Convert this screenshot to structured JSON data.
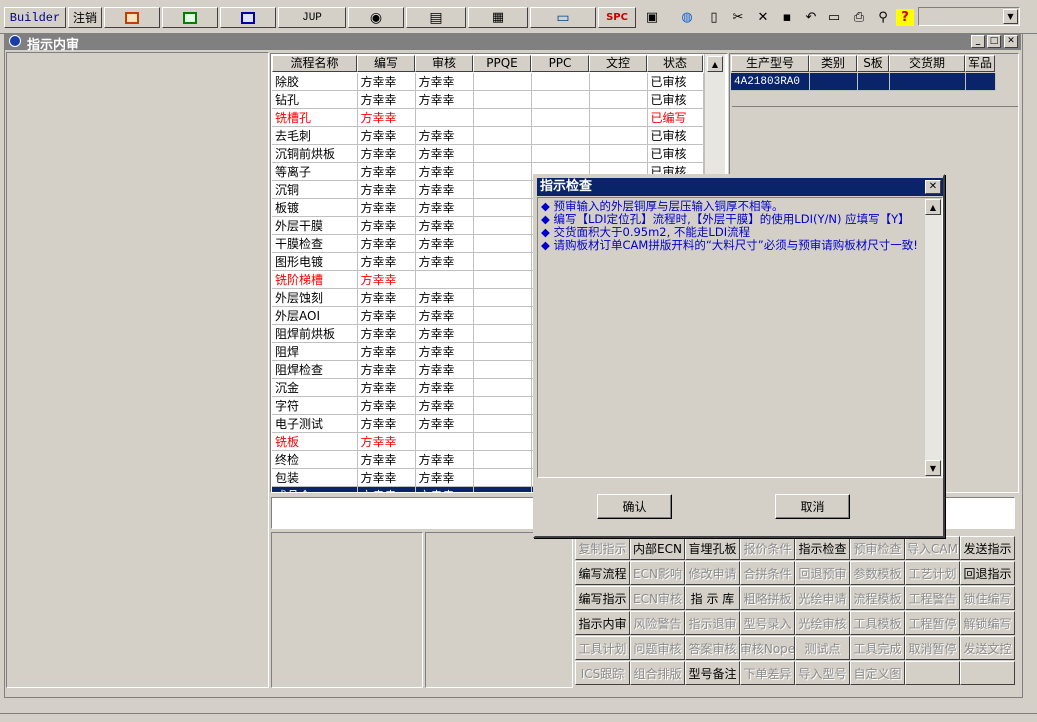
{
  "toolbar": {
    "builder_label": "Builder",
    "logout_label": "注销",
    "jup_label": "JUP",
    "spc_label": "SPC",
    "icons": [
      "ppt-icon",
      "excel-icon",
      "word-icon",
      "jup",
      "eye-icon",
      "database-icon",
      "network-icon",
      "computer-icon",
      "spc",
      "package-icon",
      "globe-icon",
      "new-doc-icon",
      "cut-icon",
      "delete-icon",
      "save-icon",
      "undo-icon",
      "preview-icon",
      "print-icon",
      "find-icon",
      "help-icon"
    ],
    "combo_value": ""
  },
  "window": {
    "title": "指示内审"
  },
  "process_table": {
    "columns": [
      "流程名称",
      "编写",
      "审核",
      "PPQE",
      "PPC",
      "文控",
      "状态"
    ],
    "rows": [
      {
        "name": "除胶",
        "writer": "方幸幸",
        "reviewer": "方幸幸",
        "status": "已审核",
        "red": false
      },
      {
        "name": "钻孔",
        "writer": "方幸幸",
        "reviewer": "方幸幸",
        "status": "已审核",
        "red": false
      },
      {
        "name": "铣槽孔",
        "writer": "方幸幸",
        "reviewer": "",
        "status": "已编写",
        "red": true
      },
      {
        "name": "去毛刺",
        "writer": "方幸幸",
        "reviewer": "方幸幸",
        "status": "已审核",
        "red": false
      },
      {
        "name": "沉铜前烘板",
        "writer": "方幸幸",
        "reviewer": "方幸幸",
        "status": "已审核",
        "red": false
      },
      {
        "name": "等离子",
        "writer": "方幸幸",
        "reviewer": "方幸幸",
        "status": "已审核",
        "red": false
      },
      {
        "name": "沉铜",
        "writer": "方幸幸",
        "reviewer": "方幸幸",
        "status": "",
        "red": false
      },
      {
        "name": "板镀",
        "writer": "方幸幸",
        "reviewer": "方幸幸",
        "status": "",
        "red": false
      },
      {
        "name": "外层干膜",
        "writer": "方幸幸",
        "reviewer": "方幸幸",
        "status": "",
        "red": false
      },
      {
        "name": "干膜检查",
        "writer": "方幸幸",
        "reviewer": "方幸幸",
        "status": "",
        "red": false
      },
      {
        "name": "图形电镀",
        "writer": "方幸幸",
        "reviewer": "方幸幸",
        "status": "",
        "red": false
      },
      {
        "name": "铣阶梯槽",
        "writer": "方幸幸",
        "reviewer": "",
        "status": "",
        "red": true
      },
      {
        "name": "外层蚀刻",
        "writer": "方幸幸",
        "reviewer": "方幸幸",
        "status": "",
        "red": false
      },
      {
        "name": "外层AOI",
        "writer": "方幸幸",
        "reviewer": "方幸幸",
        "status": "",
        "red": false
      },
      {
        "name": "阻焊前烘板",
        "writer": "方幸幸",
        "reviewer": "方幸幸",
        "status": "",
        "red": false
      },
      {
        "name": "阻焊",
        "writer": "方幸幸",
        "reviewer": "方幸幸",
        "status": "",
        "red": false
      },
      {
        "name": "阻焊检查",
        "writer": "方幸幸",
        "reviewer": "方幸幸",
        "status": "",
        "red": false
      },
      {
        "name": "沉金",
        "writer": "方幸幸",
        "reviewer": "方幸幸",
        "status": "",
        "red": false
      },
      {
        "name": "字符",
        "writer": "方幸幸",
        "reviewer": "方幸幸",
        "status": "",
        "red": false
      },
      {
        "name": "电子测试",
        "writer": "方幸幸",
        "reviewer": "方幸幸",
        "status": "",
        "red": false
      },
      {
        "name": "铣板",
        "writer": "方幸幸",
        "reviewer": "",
        "status": "",
        "red": true
      },
      {
        "name": "终检",
        "writer": "方幸幸",
        "reviewer": "方幸幸",
        "status": "",
        "red": false
      },
      {
        "name": "包装",
        "writer": "方幸幸",
        "reviewer": "方幸幸",
        "status": "",
        "red": false
      },
      {
        "name": "成品仓",
        "writer": "方幸幸",
        "reviewer": "方幸幸",
        "status": "",
        "red": false
      }
    ]
  },
  "product_table": {
    "columns": [
      "生产型号",
      "类别",
      "S板",
      "交货期",
      "军品"
    ],
    "rows": [
      [
        "4A21803RA0",
        "",
        "",
        "",
        ""
      ]
    ]
  },
  "dialog": {
    "title": "指示检查",
    "messages": [
      "◆ 预审输入的外层铜厚与层压输入铜厚不相等。",
      "◆ 编写【LDI定位孔】流程时,【外层干膜】的使用LDI(Y/N) 应填写【Y】",
      "◆ 交货面积大于0.95m2, 不能走LDI流程",
      "◆ 请购板材订单CAM拼版开料的“大料尺寸”必须与预审请购板材尺寸一致!"
    ],
    "ok_label": "确认",
    "cancel_label": "取消"
  },
  "actions": [
    [
      {
        "l": "复制指示",
        "e": false
      },
      {
        "l": "内部ECN",
        "e": true
      },
      {
        "l": "盲埋孔板",
        "e": true
      },
      {
        "l": "报价条件",
        "e": false
      },
      {
        "l": "指示检查",
        "e": true
      },
      {
        "l": "预审检查",
        "e": false
      },
      {
        "l": "导入CAM",
        "e": false
      },
      {
        "l": "发送指示",
        "e": true
      }
    ],
    [
      {
        "l": "编写流程",
        "e": true
      },
      {
        "l": "ECN影响",
        "e": false
      },
      {
        "l": "修改申请",
        "e": false
      },
      {
        "l": "合拼条件",
        "e": false
      },
      {
        "l": "回退预审",
        "e": false
      },
      {
        "l": "参数模板",
        "e": false
      },
      {
        "l": "工艺计划",
        "e": false
      },
      {
        "l": "回退指示",
        "e": true
      }
    ],
    [
      {
        "l": "编写指示",
        "e": true
      },
      {
        "l": "ECN审核",
        "e": false
      },
      {
        "l": "指 示 库",
        "e": true
      },
      {
        "l": "粗略拼板",
        "e": false
      },
      {
        "l": "光绘申请",
        "e": false
      },
      {
        "l": "流程模板",
        "e": false
      },
      {
        "l": "工程警告",
        "e": false
      },
      {
        "l": "锁住编写",
        "e": false
      }
    ],
    [
      {
        "l": "指示内审",
        "e": true
      },
      {
        "l": "风险警告",
        "e": false
      },
      {
        "l": "指示退审",
        "e": false
      },
      {
        "l": "型号录入",
        "e": false
      },
      {
        "l": "光绘审核",
        "e": false
      },
      {
        "l": "工具模板",
        "e": false
      },
      {
        "l": "工程暂停",
        "e": false
      },
      {
        "l": "解锁编写",
        "e": false
      }
    ],
    [
      {
        "l": "工具计划",
        "e": false
      },
      {
        "l": "问题审核",
        "e": false
      },
      {
        "l": "答案审核",
        "e": false
      },
      {
        "l": "审核Nope",
        "e": false
      },
      {
        "l": "测试点",
        "e": false
      },
      {
        "l": "工具完成",
        "e": false
      },
      {
        "l": "取消暂停",
        "e": false
      },
      {
        "l": "发送文控",
        "e": false
      }
    ],
    [
      {
        "l": "ICS跟踪",
        "e": false
      },
      {
        "l": "组合排版",
        "e": false
      },
      {
        "l": "型号备注",
        "e": true
      },
      {
        "l": "下单差异",
        "e": false
      },
      {
        "l": "导入型号",
        "e": false
      },
      {
        "l": "自定义图",
        "e": false
      },
      {
        "l": "",
        "e": false
      },
      {
        "l": "",
        "e": false
      }
    ]
  ]
}
